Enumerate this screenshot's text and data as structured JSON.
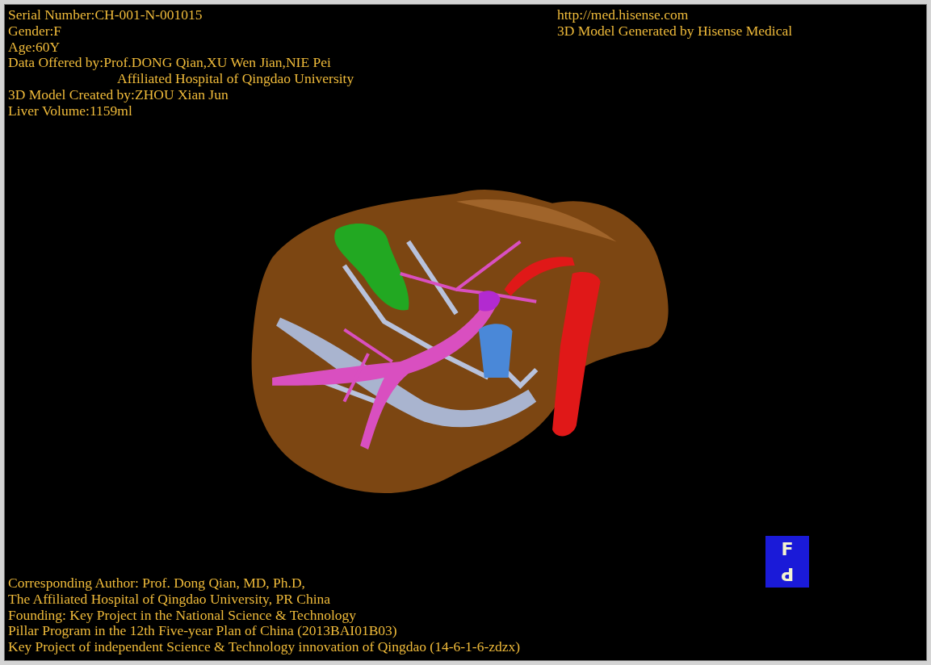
{
  "info_top_left": [
    {
      "text": "Serial Number:CH-001-N-001015",
      "kind": "line"
    },
    {
      "text": "Gender:F",
      "kind": "line"
    },
    {
      "text": "Age:60Y",
      "kind": "line"
    },
    {
      "text": "Data Offered by:Prof.DONG Qian,XU Wen Jian,NIE Pei",
      "kind": "line"
    },
    {
      "text": "Affiliated Hospital of Qingdao University",
      "kind": "continuation"
    },
    {
      "text": "3D Model Created by:ZHOU Xian Jun",
      "kind": "line"
    },
    {
      "text": "Liver Volume:1159ml",
      "kind": "line"
    }
  ],
  "info_top_right": [
    "http://med.hisense.com",
    "3D Model Generated by Hisense Medical"
  ],
  "model": {
    "kind": "organ"
  },
  "info_bottom": [
    "Corresponding Author: Prof. Dong Qian, MD, Ph.D,",
    "The Affiliated Hospital of Qingdao University, PR China",
    "Founding: Key Project in the National Science & Technology",
    "Pillar Program in the 12th Five-year Plan of China (2013BAI01B03)",
    "Key Project of independent Science & Technology innovation of Qingdao (14-6-1-6-zdzx)"
  ],
  "orientation_cube": {
    "front": "F",
    "bottom": "P"
  }
}
